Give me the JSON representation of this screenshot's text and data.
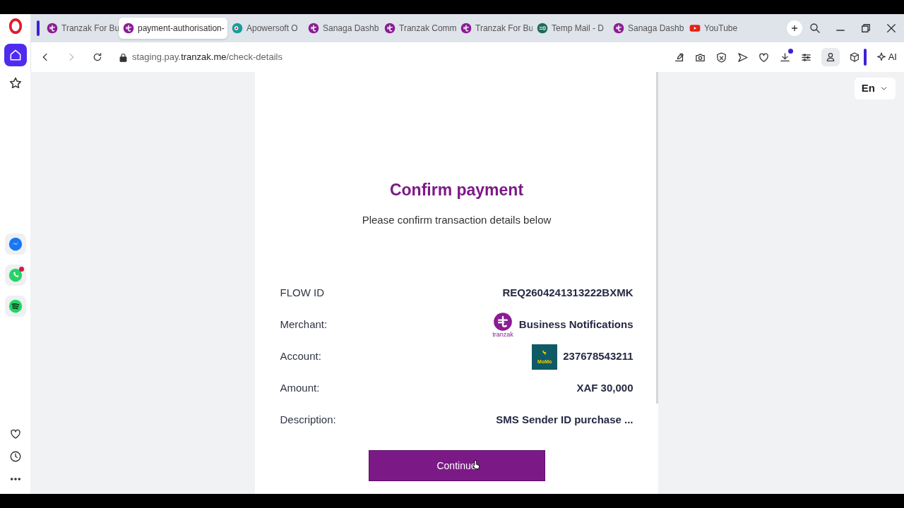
{
  "tabs": [
    {
      "kind": "tranzak",
      "label": "Tranzak For Bu",
      "selected": false
    },
    {
      "kind": "tranzak",
      "label": "payment-authorisation-",
      "selected": true
    },
    {
      "kind": "camera",
      "label": "Apowersoft O",
      "selected": false
    },
    {
      "kind": "tranzak",
      "label": "Sanaga Dashb",
      "selected": false
    },
    {
      "kind": "tranzak",
      "label": "Tranzak Comm",
      "selected": false
    },
    {
      "kind": "tranzak",
      "label": "Tranzak For Bu",
      "selected": false
    },
    {
      "kind": "mail",
      "label": "Temp Mail - D",
      "selected": false
    },
    {
      "kind": "tranzak",
      "label": "Sanaga Dashb",
      "selected": false
    },
    {
      "kind": "youtube",
      "label": "YouTube",
      "selected": false
    }
  ],
  "address": {
    "prefix": "staging.pay.",
    "domain": "tranzak.me",
    "path": "/check-details"
  },
  "toolbar": {
    "ai_label": "AI",
    "download_badge": true
  },
  "sidebar": {
    "items": [
      {
        "kind": "messenger",
        "badge": false
      },
      {
        "kind": "whatsapp",
        "badge": true
      },
      {
        "kind": "spotify",
        "badge": false
      }
    ]
  },
  "language": "En",
  "payment": {
    "title": "Confirm payment",
    "subtitle": "Please confirm transaction details below",
    "rows": [
      {
        "kind": "text",
        "label": "FLOW ID",
        "value": "REQ2604241313222BXMK"
      },
      {
        "kind": "merchant",
        "label": "Merchant:",
        "value": "Business Notifications",
        "logo_text": "tranzak"
      },
      {
        "kind": "account",
        "label": "Account:",
        "value": "237678543211",
        "logo_text": "MoMo"
      },
      {
        "kind": "text",
        "label": "Amount:",
        "value": "XAF 30,000"
      },
      {
        "kind": "text",
        "label": "Description:",
        "value": "SMS Sender ID purchase ..."
      }
    ],
    "button": "Continue"
  }
}
